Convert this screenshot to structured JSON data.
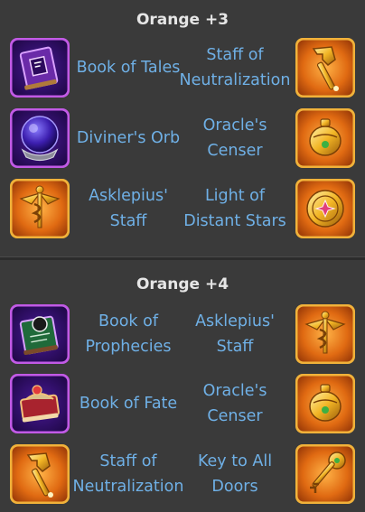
{
  "sections": [
    {
      "title": "Orange +3",
      "rows": [
        {
          "left": {
            "name": "Book of Tales",
            "icon": "book-of-tales-icon"
          },
          "right": {
            "name": "Staff of Neutralization",
            "icon": "staff-of-neutralization-icon"
          }
        },
        {
          "left": {
            "name": "Diviner's Orb",
            "icon": "diviners-orb-icon"
          },
          "right": {
            "name": "Oracle's Censer",
            "icon": "oracles-censer-icon"
          }
        },
        {
          "left": {
            "name": "Asklepius' Staff",
            "icon": "asklepius-staff-icon"
          },
          "right": {
            "name": "Light of Distant Stars",
            "icon": "light-of-distant-stars-icon"
          }
        }
      ]
    },
    {
      "title": "Orange +4",
      "rows": [
        {
          "left": {
            "name": "Book of Prophecies",
            "icon": "book-of-prophecies-icon"
          },
          "right": {
            "name": "Asklepius' Staff",
            "icon": "asklepius-staff-icon"
          }
        },
        {
          "left": {
            "name": "Book of Fate",
            "icon": "book-of-fate-icon"
          },
          "right": {
            "name": "Oracle's Censer",
            "icon": "oracles-censer-icon"
          }
        },
        {
          "left": {
            "name": "Staff of Neutralization",
            "icon": "staff-of-neutralization-icon"
          },
          "right": {
            "name": "Key to All Doors",
            "icon": "key-to-all-doors-icon"
          }
        }
      ]
    }
  ],
  "colors": {
    "background": "#3a3a3a",
    "title": "#e6e6e6",
    "item_label": "#6fb0e6",
    "purple_frame": "#b44fd6",
    "gold_frame": "#e0a030"
  }
}
